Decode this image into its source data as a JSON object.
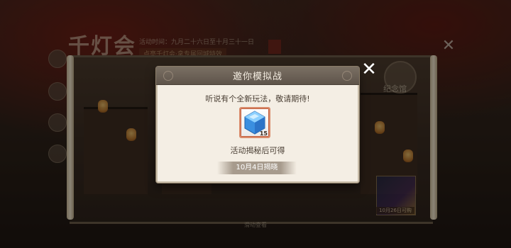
{
  "background": {
    "game_title": "千灯会",
    "event_time": "活动时间：九月二十六日至十月三十一日",
    "event_subtitle": "点亮千灯会·拿专属回城特效",
    "badge_label": "纪念馆",
    "side_thumb_caption": "10月26日可购",
    "scroll_hint": "滑动查看"
  },
  "modal": {
    "title": "邀你模拟战",
    "message": "听说有个全新玩法，敬请期待!",
    "item": {
      "icon": "blue-crystal-icon",
      "count": "15"
    },
    "caption": "活动揭秘后可得",
    "reveal_date": "10月4日揭晓"
  },
  "colors": {
    "modal_bg": "#f4eee4",
    "header_bg": "#5e544a",
    "accent_border": "#d98a6a",
    "crystal": "#3a8fe0"
  }
}
